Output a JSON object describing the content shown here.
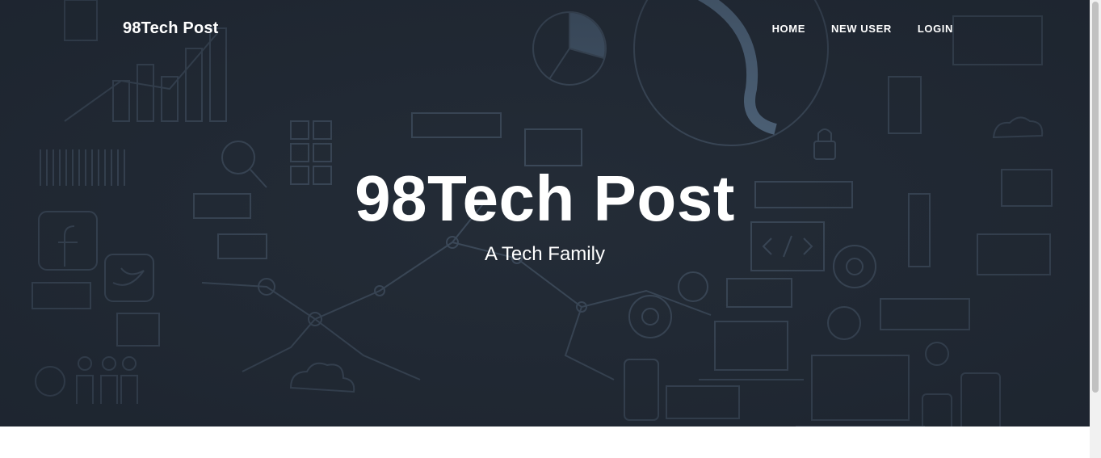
{
  "navbar": {
    "brand": "98Tech Post",
    "links": [
      {
        "label": "HOME"
      },
      {
        "label": "NEW USER"
      },
      {
        "label": "LOGIN"
      }
    ]
  },
  "hero": {
    "title": "98Tech Post",
    "subtitle": "A Tech Family",
    "background_icons": [
      "chart-icon",
      "globe-icon",
      "pie-chart-icon",
      "facebook-icon",
      "twitter-icon",
      "gear-icon",
      "laptop-icon",
      "phone-icon",
      "cloud-icon",
      "lock-icon",
      "code-icon",
      "people-icon",
      "network-icon"
    ]
  },
  "colors": {
    "hero_background": "#232b36",
    "line_art": "#4a5a6c",
    "accent_art": "#6d8aa8",
    "text": "#ffffff"
  }
}
